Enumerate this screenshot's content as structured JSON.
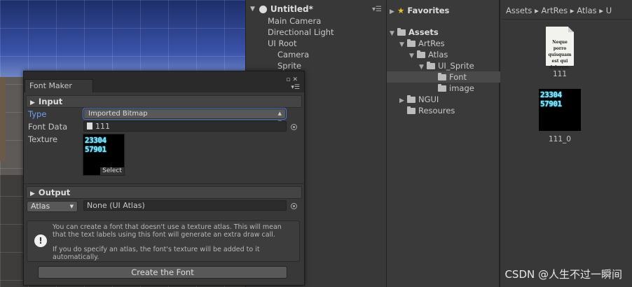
{
  "hierarchy": {
    "scene_name": "Untitled*",
    "items": [
      {
        "label": "Main Camera"
      },
      {
        "label": "Directional Light"
      },
      {
        "label": "UI Root"
      },
      {
        "label": "Camera"
      },
      {
        "label": "Sprite"
      }
    ]
  },
  "project": {
    "favorites_label": "Favorites",
    "tree": {
      "assets": "Assets",
      "artres": "ArtRes",
      "atlas": "Atlas",
      "ui_sprite": "UI_Sprite",
      "font": "Font",
      "image": "image",
      "ngui": "NGUI",
      "resoures": "Resoures"
    },
    "breadcrumb": "Assets ▸ ArtRes ▸ Atlas ▸ U",
    "assets": [
      {
        "name": "111",
        "thumb_text": "Neque porro quisquam est qui dolorem."
      },
      {
        "name": "111_0",
        "thumb_lines": [
          "23304",
          "57901"
        ]
      }
    ]
  },
  "font_maker": {
    "title": "Font Maker",
    "input_section": "Input",
    "type_label": "Type",
    "type_value": "Imported Bitmap",
    "font_data_label": "Font Data",
    "font_data_value": "111",
    "texture_label": "Texture",
    "texture_lines": [
      "23304",
      "57901"
    ],
    "texture_select": "Select",
    "output_section": "Output",
    "atlas_dropdown": "Atlas",
    "atlas_value": "None (UI Atlas)",
    "help_text_1": "You can create a font that doesn't use a texture atlas. This will mean that the text labels using this font will generate an extra draw call.",
    "help_text_2": "If you do specify an atlas, the font's texture will be added to it automatically.",
    "create_button": "Create the Font"
  },
  "watermark": "CSDN @人生不过一瞬间",
  "colors": {
    "panel_bg": "#383838",
    "highlight_label": "#6d9ff5",
    "digit_glow": "#7fe8ff"
  }
}
